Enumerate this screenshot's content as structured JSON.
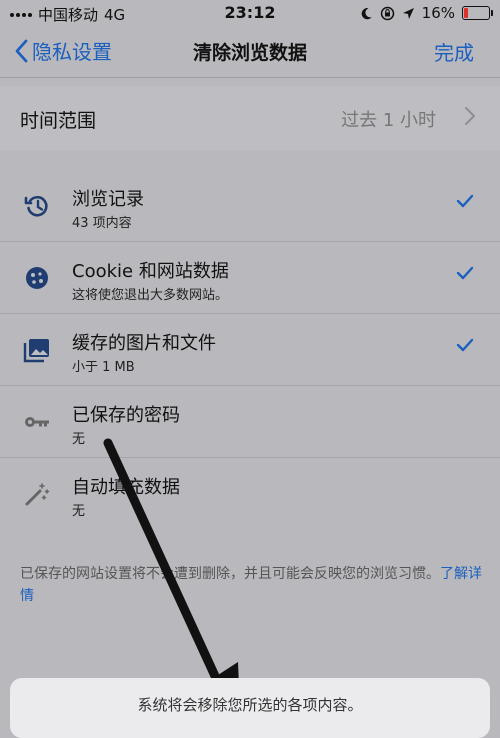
{
  "status_bar": {
    "carrier": "中国移动",
    "network": "4G",
    "time": "23:12",
    "battery_percent": "16%",
    "battery_level": 0.16,
    "icons": [
      "signal-dots-icon",
      "moon-icon",
      "rotation-lock-icon",
      "location-arrow-icon",
      "battery-icon"
    ]
  },
  "nav": {
    "back_label": "隐私设置",
    "title": "清除浏览数据",
    "done_label": "完成"
  },
  "time_range": {
    "label": "时间范围",
    "value": "过去 1 小时"
  },
  "items": [
    {
      "title": "浏览记录",
      "subtitle": "43 项内容",
      "checked": true,
      "icon": "history-icon"
    },
    {
      "title": "Cookie 和网站数据",
      "subtitle": "这将使您退出大多数网站。",
      "checked": true,
      "icon": "cookie-icon"
    },
    {
      "title": "缓存的图片和文件",
      "subtitle": "小于 1 MB",
      "checked": true,
      "icon": "image-icon"
    },
    {
      "title": "已保存的密码",
      "subtitle": "无",
      "checked": false,
      "icon": "key-icon"
    },
    {
      "title": "自动填充数据",
      "subtitle": "无",
      "checked": false,
      "icon": "magic-wand-icon"
    }
  ],
  "footer": {
    "note": "已保存的网站设置将不会遭到删除，并且可能会反映您的浏览习惯。",
    "link": "了解详情"
  },
  "action_sheet": {
    "message": "系统将会移除您所选的各项内容。"
  },
  "colors": {
    "accent": "#1b5fbf",
    "overlay_bg": "#b9b9bd",
    "battery_low": "#e0302a"
  }
}
